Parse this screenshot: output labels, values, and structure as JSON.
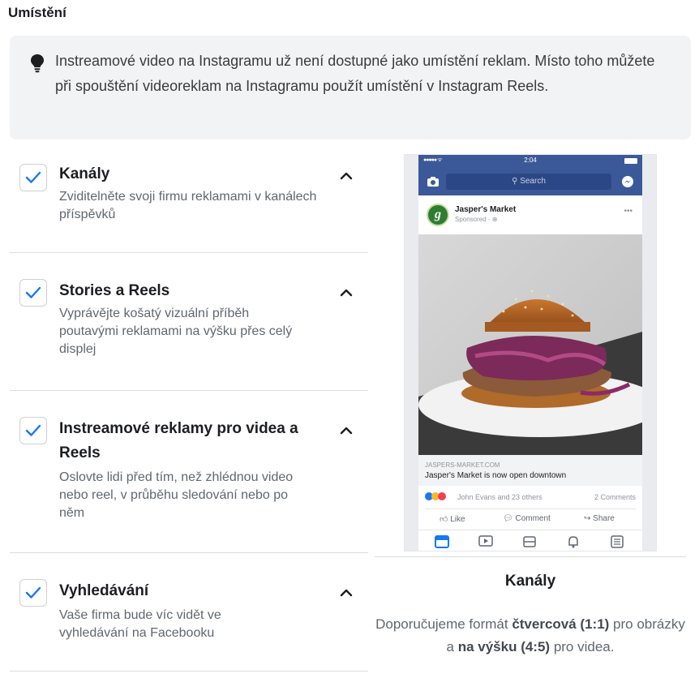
{
  "section_title": "Umístění",
  "notice": {
    "text": "Instreamové video na Instagramu už není dostupné jako umístění reklam. Místo toho můžete při spouštění videoreklam na Instagramu použít umístění v Instagram Reels."
  },
  "placements": [
    {
      "title": "Kanály",
      "description": "Zviditelněte svoji firmu reklamami v kanálech příspěvků",
      "checked": true
    },
    {
      "title": "Stories a Reels",
      "description": "Vyprávějte košatý vizuální příběh poutavými reklamami na výšku přes celý displej",
      "checked": true
    },
    {
      "title": "Instreamové reklamy pro videa a Reels",
      "description": "Oslovte lidi před tím, než zhlédnou video nebo reel, v průběhu sledování nebo po něm",
      "checked": true
    },
    {
      "title": "Vyhledávání",
      "description": "Vaše firma bude víc vidět ve vyhledávání na Facebooku",
      "checked": true
    }
  ],
  "preview": {
    "phone": {
      "status_time": "2:04",
      "search_placeholder": "Search",
      "page_name": "Jasper's Market",
      "sponsored": "Sponsored · ⊕",
      "link_domain": "JASPERS-MARKET.COM",
      "link_title": "Jasper's Market is now open downtown",
      "reactions_text": "John Evans and 23 others",
      "comments_count": "2 Comments",
      "action_like": "Like",
      "action_comment": "Comment",
      "action_share": "Share"
    },
    "title": "Kanály",
    "desc_part1": "Doporučujeme formát ",
    "desc_bold1": "čtvercová (1:1)",
    "desc_part2": " pro obrázky a ",
    "desc_bold2": "na výšku (4:5)",
    "desc_part3": " pro videa."
  },
  "colors": {
    "accent": "#1877f2",
    "facebook_blue": "#3b5998",
    "notice_bg": "#f2f3f5"
  }
}
